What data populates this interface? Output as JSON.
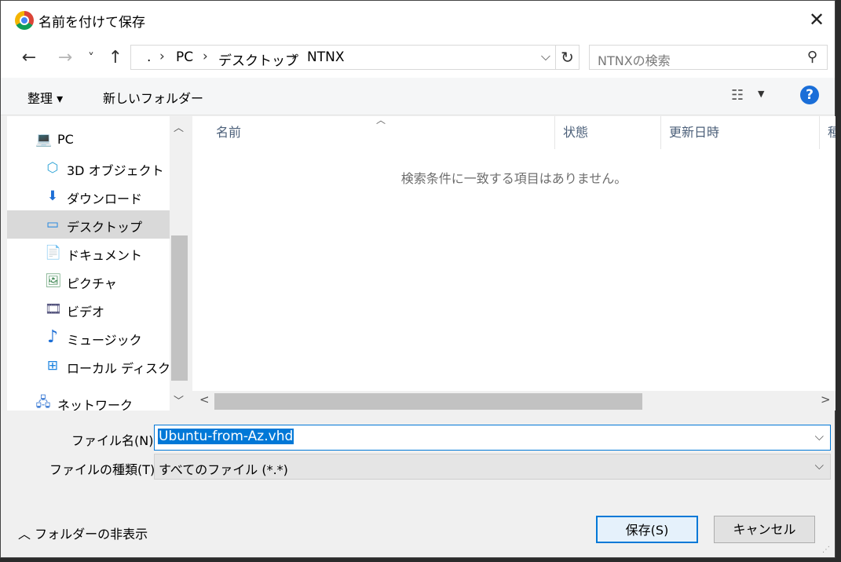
{
  "window": {
    "title": "名前を付けて保存",
    "close_glyph": "✕"
  },
  "nav": {
    "back": "←",
    "forward": "→",
    "recent": "˅",
    "up": "↑"
  },
  "address": {
    "crumbs": [
      ".",
      "PC",
      "デスクトップ",
      "NTNX"
    ],
    "separator": "›",
    "dropdown": "⌵",
    "refresh": "↻"
  },
  "search": {
    "placeholder": "NTNXの検索",
    "icon": "⚲"
  },
  "toolbar": {
    "organize": "整理 ▾",
    "new_folder": "新しいフォルダー",
    "view_glyph": "☷",
    "view_dropdown": "▼",
    "help": "?"
  },
  "sidebar": {
    "items": [
      {
        "label": "PC",
        "icon": "pc-icon",
        "glyph": "💻"
      },
      {
        "label": "3D オブジェクト",
        "icon": "3d-objects-icon",
        "glyph": "⬡"
      },
      {
        "label": "ダウンロード",
        "icon": "download-icon",
        "glyph": "⬇"
      },
      {
        "label": "デスクトップ",
        "icon": "desktop-icon",
        "glyph": "▭"
      },
      {
        "label": "ドキュメント",
        "icon": "document-icon",
        "glyph": "📄"
      },
      {
        "label": "ピクチャ",
        "icon": "pictures-icon",
        "glyph": "🖼"
      },
      {
        "label": "ビデオ",
        "icon": "video-icon",
        "glyph": "🎞"
      },
      {
        "label": "ミュージック",
        "icon": "music-icon",
        "glyph": "♪"
      },
      {
        "label": "ローカル ディスク (C",
        "icon": "local-disk-icon",
        "glyph": "⊞"
      },
      {
        "label": "ネットワーク",
        "icon": "network-icon",
        "glyph": "🖧"
      }
    ],
    "selected_index": 3,
    "scroll_up": "︿",
    "scroll_down": "﹀"
  },
  "filelist": {
    "columns": [
      "名前",
      "状態",
      "更新日時",
      "種"
    ],
    "sort_indicator": "︿",
    "empty_message": "検索条件に一致する項目はありません。",
    "scroll_left": "<",
    "scroll_right": ">"
  },
  "form": {
    "filename_label": "ファイル名(N):",
    "filename_value": "Ubuntu-from-Az.vhd",
    "filetype_label": "ファイルの種類(T):",
    "filetype_value": "すべてのファイル (*.*)",
    "caret": "⌵"
  },
  "footer": {
    "hide_folders": "︿ フォルダーの非表示",
    "save": "保存(S)",
    "cancel": "キャンセル",
    "grip": "⋰"
  }
}
